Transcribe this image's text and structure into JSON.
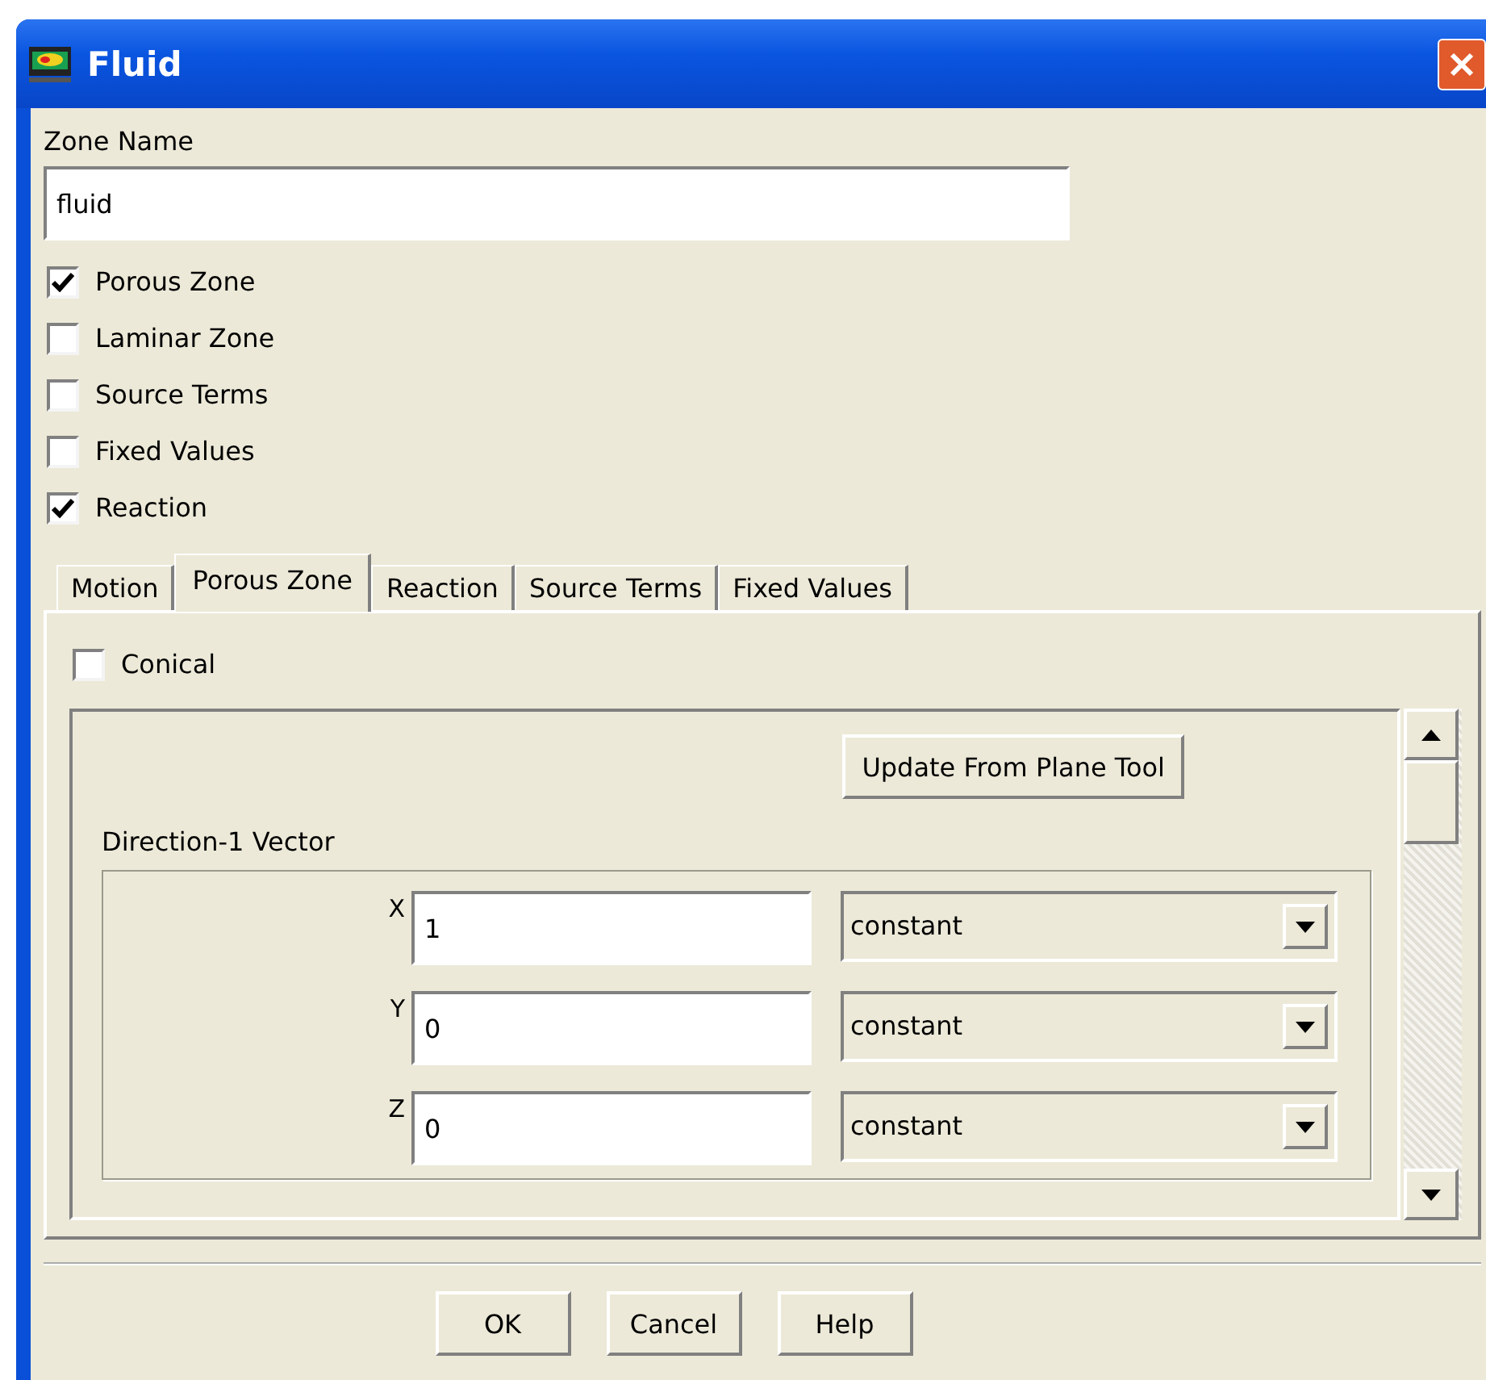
{
  "window": {
    "title": "Fluid"
  },
  "zone_name": {
    "label": "Zone Name",
    "value": "fluid"
  },
  "options": [
    {
      "label": "Porous Zone",
      "checked": true
    },
    {
      "label": "Laminar Zone",
      "checked": false
    },
    {
      "label": "Source Terms",
      "checked": false
    },
    {
      "label": "Fixed Values",
      "checked": false
    },
    {
      "label": "Reaction",
      "checked": true
    }
  ],
  "tabs": [
    {
      "label": "Motion",
      "selected": false
    },
    {
      "label": "Porous Zone",
      "selected": true
    },
    {
      "label": "Reaction",
      "selected": false
    },
    {
      "label": "Source Terms",
      "selected": false
    },
    {
      "label": "Fixed Values",
      "selected": false
    }
  ],
  "conical": {
    "label": "Conical",
    "checked": false
  },
  "update_button": "Update From Plane Tool",
  "direction_1_vector": {
    "label": "Direction-1 Vector",
    "rows": [
      {
        "axis": "X",
        "value": "1",
        "profile": "constant"
      },
      {
        "axis": "Y",
        "value": "0",
        "profile": "constant"
      },
      {
        "axis": "Z",
        "value": "0",
        "profile": "constant"
      }
    ]
  },
  "buttons": [
    "OK",
    "Cancel",
    "Help"
  ]
}
